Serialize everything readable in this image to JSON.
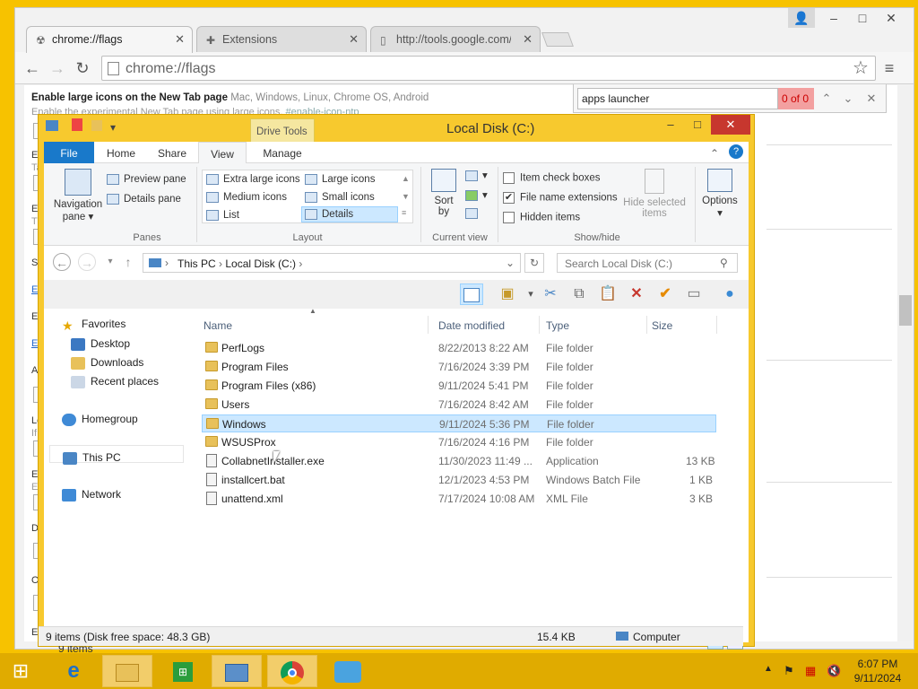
{
  "chrome": {
    "tabs": [
      {
        "label": "chrome://flags",
        "icon": "flags-icon"
      },
      {
        "label": "Extensions",
        "icon": "puzzle-icon"
      },
      {
        "label": "http://tools.google.com/c",
        "icon": "page-icon"
      }
    ],
    "address": "chrome://flags",
    "find": {
      "query": "apps launcher",
      "count": "0 of 0"
    },
    "flag": {
      "title": "Enable large icons on the New Tab page",
      "platforms": "Mac, Windows, Linux, Chrome OS, Android",
      "desc": "Enable the experimental New Tab page using large icons.",
      "anchor": "#enable-icon-ntp"
    },
    "fragments": [
      "En",
      "Ta",
      "En",
      "Tr",
      "Sy",
      "En",
      "En",
      "En",
      "Au",
      "Le",
      "If",
      "En",
      "Ex",
      "Di",
      "Lo",
      "O",
      "Ov",
      "En"
    ]
  },
  "explorer": {
    "title": "Local Disk (C:)",
    "drive_tools": "Drive Tools",
    "ribbon_tabs": [
      "File",
      "Home",
      "Share",
      "View",
      "Manage"
    ],
    "ribbon": {
      "navigation_pane": "Navigation pane",
      "preview_pane": "Preview pane",
      "details_pane": "Details pane",
      "panes_group": "Panes",
      "layouts": [
        "Extra large icons",
        "Large icons",
        "Medium icons",
        "Small icons",
        "List",
        "Details"
      ],
      "layout_group": "Layout",
      "sort_by": "Sort by",
      "current_view_group": "Current view",
      "item_check_boxes": "Item check boxes",
      "file_name_extensions": "File name extensions",
      "hidden_items": "Hidden items",
      "hide_selected_items": "Hide selected items",
      "show_hide_group": "Show/hide",
      "options": "Options"
    },
    "breadcrumb": [
      "This PC",
      "Local Disk (C:)"
    ],
    "search_placeholder": "Search Local Disk (C:)",
    "nav": {
      "favorites": "Favorites",
      "desktop": "Desktop",
      "downloads": "Downloads",
      "recent": "Recent places",
      "homegroup": "Homegroup",
      "thispc": "This PC",
      "network": "Network"
    },
    "columns": {
      "name": "Name",
      "date": "Date modified",
      "type": "Type",
      "size": "Size"
    },
    "files": [
      {
        "name": "PerfLogs",
        "date": "8/22/2013 8:22 AM",
        "type": "File folder",
        "size": "",
        "kind": "folder"
      },
      {
        "name": "Program Files",
        "date": "7/16/2024 3:39 PM",
        "type": "File folder",
        "size": "",
        "kind": "folder"
      },
      {
        "name": "Program Files (x86)",
        "date": "9/11/2024 5:41 PM",
        "type": "File folder",
        "size": "",
        "kind": "folder"
      },
      {
        "name": "Users",
        "date": "7/16/2024 8:42 AM",
        "type": "File folder",
        "size": "",
        "kind": "folder"
      },
      {
        "name": "Windows",
        "date": "9/11/2024 5:36 PM",
        "type": "File folder",
        "size": "",
        "kind": "folder"
      },
      {
        "name": "WSUSProx",
        "date": "7/16/2024 4:16 PM",
        "type": "File folder",
        "size": "",
        "kind": "folder"
      },
      {
        "name": "CollabnetInstaller.exe",
        "date": "11/30/2023 11:49 ...",
        "type": "Application",
        "size": "13 KB",
        "kind": "file"
      },
      {
        "name": "installcert.bat",
        "date": "12/1/2023 4:53 PM",
        "type": "Windows Batch File",
        "size": "1 KB",
        "kind": "file"
      },
      {
        "name": "unattend.xml",
        "date": "7/17/2024 10:08 AM",
        "type": "XML File",
        "size": "3 KB",
        "kind": "file"
      }
    ],
    "item_count": "9 items",
    "status": {
      "left": "9 items (Disk free space: 48.3 GB)",
      "size": "15.4 KB",
      "location": "Computer"
    }
  },
  "taskbar": {
    "time": "6:07 PM",
    "date": "9/11/2024"
  },
  "colors": {
    "accent": "#1979ca",
    "desktop": "#f7c200",
    "selection": "#cce8ff"
  }
}
